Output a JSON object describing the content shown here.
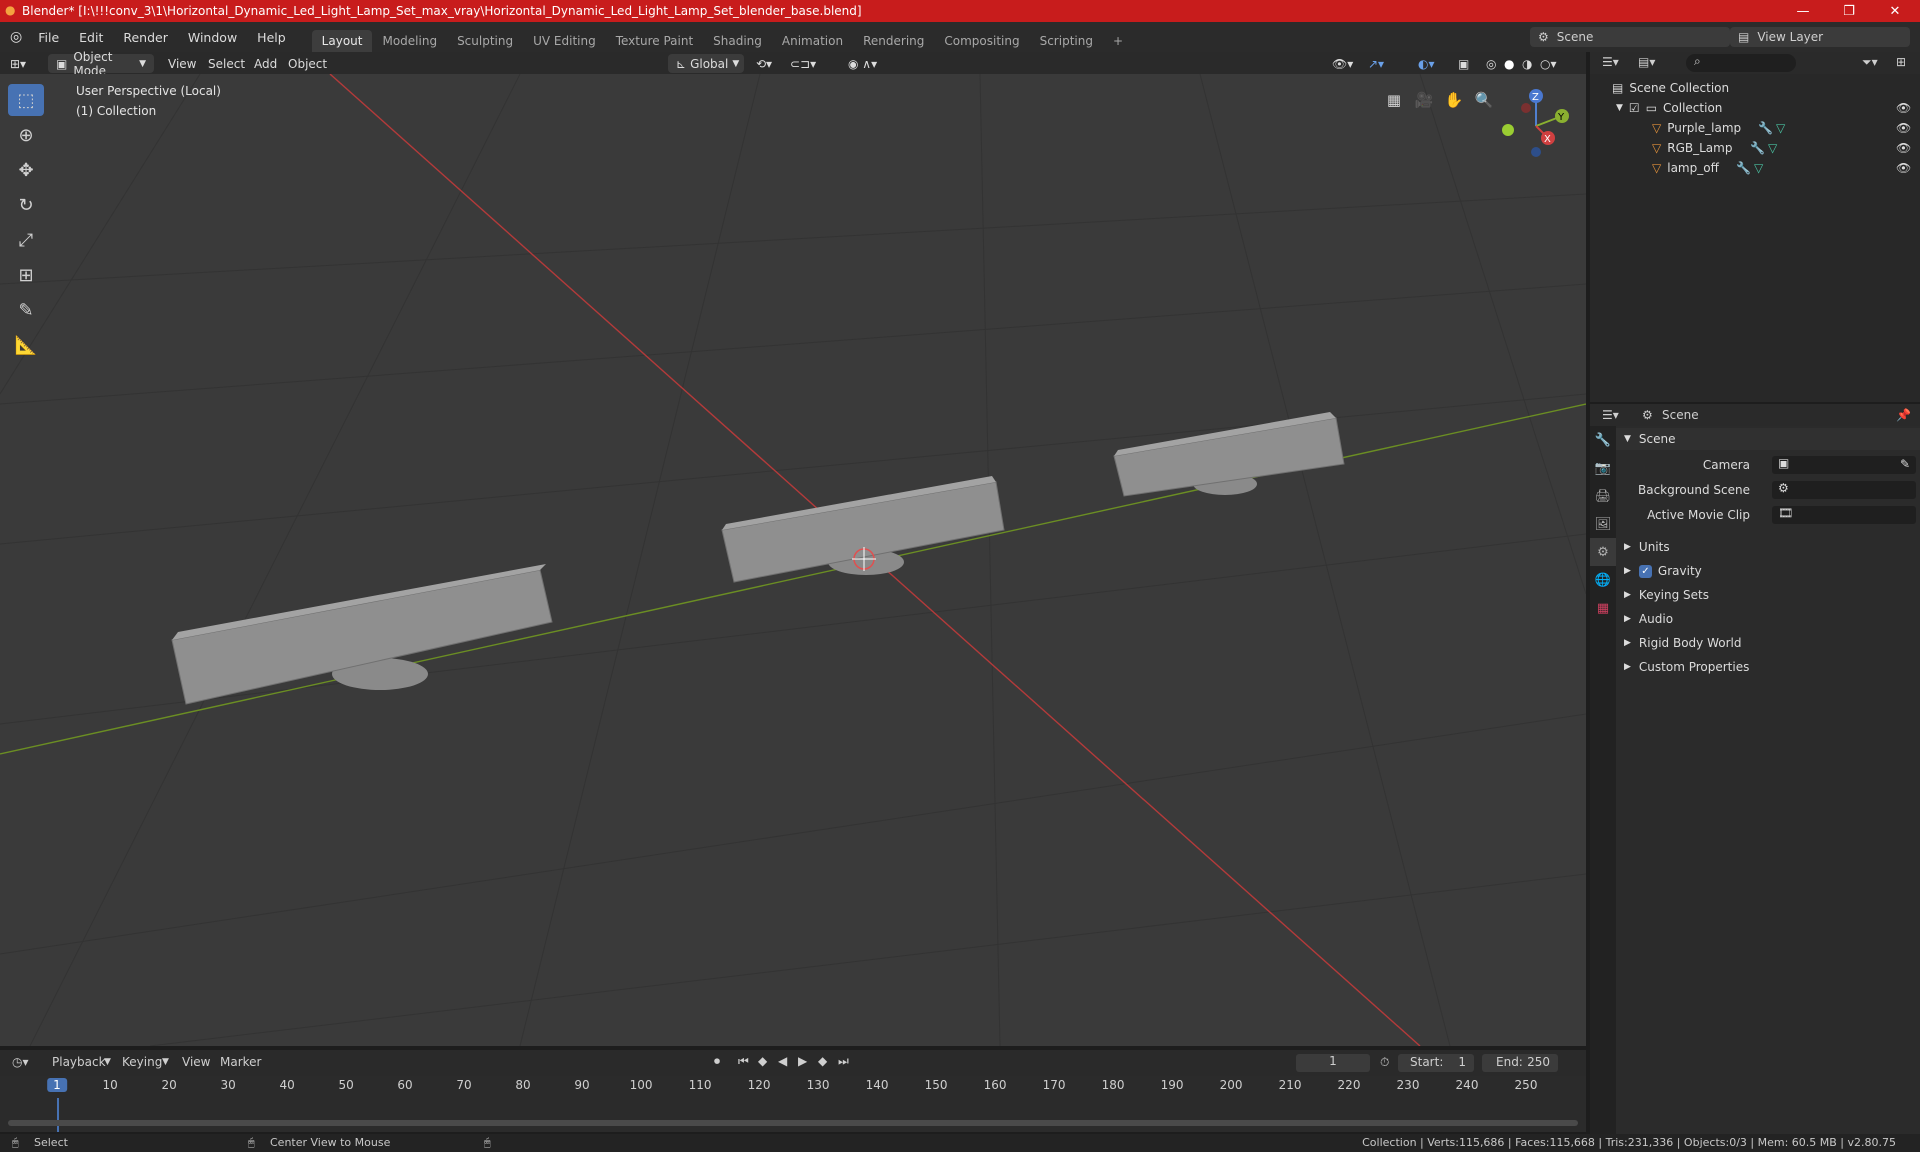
{
  "window": {
    "title": "Blender* [I:\\!!!conv_3\\1\\Horizontal_Dynamic_Led_Light_Lamp_Set_max_vray\\Horizontal_Dynamic_Led_Light_Lamp_Set_blender_base.blend]",
    "controls": {
      "minimize": "—",
      "restore": "❐",
      "close": "✕"
    }
  },
  "menubar": {
    "menus": [
      "File",
      "Edit",
      "Render",
      "Window",
      "Help"
    ],
    "workspaces": [
      "Layout",
      "Modeling",
      "Sculpting",
      "UV Editing",
      "Texture Paint",
      "Shading",
      "Animation",
      "Rendering",
      "Compositing",
      "Scripting"
    ],
    "active_workspace": "Layout",
    "add_tab": "+",
    "scene_label": "Scene",
    "view_layer_label": "View Layer"
  },
  "viewport_header": {
    "mode": "Object Mode",
    "menus": [
      "View",
      "Select",
      "Add",
      "Object"
    ],
    "transform_orientation": "Global"
  },
  "viewport": {
    "perspective_label": "User Perspective (Local)",
    "collection_label": "(1) Collection",
    "gizmo": {
      "z": "Z",
      "y": "Y",
      "x": "X"
    },
    "colors": {
      "background": "#3a3a3a",
      "x_axis": "#b33a3a",
      "y_axis": "#6b8e23",
      "lamp": "#8f8f8f"
    }
  },
  "outliner": {
    "root": "Scene Collection",
    "collection": "Collection",
    "objects": [
      "Purple_lamp",
      "RGB_Lamp",
      "lamp_off"
    ]
  },
  "properties": {
    "header": "Scene",
    "section": "Scene",
    "fields": [
      {
        "label": "Camera",
        "value": ""
      },
      {
        "label": "Background Scene",
        "value": ""
      },
      {
        "label": "Active Movie Clip",
        "value": ""
      }
    ],
    "panels": [
      "Units",
      "Gravity",
      "Keying Sets",
      "Audio",
      "Rigid Body World",
      "Custom Properties"
    ],
    "gravity_checked": true
  },
  "timeline": {
    "menus": [
      "Playback",
      "Keying",
      "View",
      "Marker"
    ],
    "current_frame": "1",
    "start_label": "Start:",
    "start": "1",
    "end_label": "End:",
    "end": "250",
    "ticks": [
      "1",
      "10",
      "20",
      "30",
      "40",
      "50",
      "60",
      "70",
      "80",
      "90",
      "100",
      "110",
      "120",
      "130",
      "140",
      "150",
      "160",
      "170",
      "180",
      "190",
      "200",
      "210",
      "220",
      "230",
      "240",
      "250"
    ]
  },
  "statusbar": {
    "select": "Select",
    "center": "Center View to Mouse",
    "stats": "Collection | Verts:115,686 | Faces:115,668 | Tris:231,336 | Objects:0/3 | Mem: 60.5 MB | v2.80.75"
  }
}
